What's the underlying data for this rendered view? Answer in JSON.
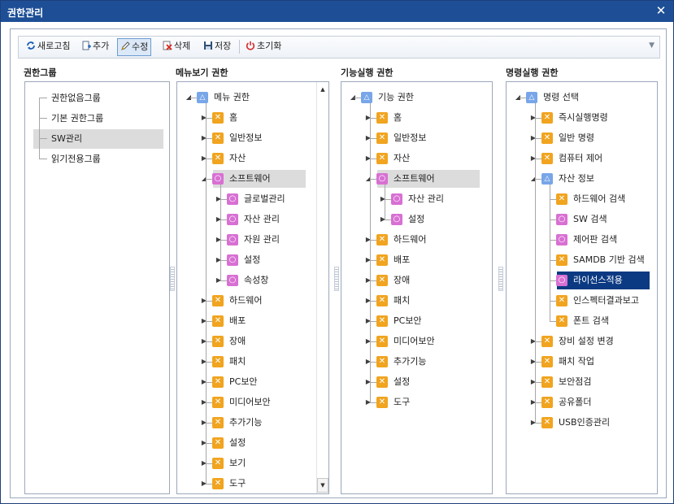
{
  "window": {
    "title": "권한관리",
    "close": "✕"
  },
  "toolbar": {
    "refresh": "새로고침",
    "add": "추가",
    "edit": "수정",
    "delete": "삭제",
    "save": "저장",
    "reset": "초기화"
  },
  "panels": {
    "groups_title": "권한그룹",
    "menu_title": "메뉴보기 권한",
    "func_title": "기능실행 권한",
    "cmd_title": "명령실행 권한"
  },
  "groups": [
    "권한없음그룹",
    "기본 권한그룹",
    "SW관리",
    "읽기전용그룹"
  ],
  "selected_group": "SW관리",
  "menu_tree": [
    {
      "label": "메뉴 권한",
      "icon": "t",
      "level": 0,
      "exp": "open"
    },
    {
      "label": "홈",
      "icon": "x",
      "level": 1,
      "exp": "closed"
    },
    {
      "label": "일반정보",
      "icon": "x",
      "level": 1,
      "exp": "closed"
    },
    {
      "label": "자산",
      "icon": "x",
      "level": 1,
      "exp": "closed"
    },
    {
      "label": "소프트웨어",
      "icon": "o",
      "level": 1,
      "exp": "open",
      "hl": true
    },
    {
      "label": "글로벌관리",
      "icon": "o",
      "level": 2,
      "exp": "closed"
    },
    {
      "label": "자산 관리",
      "icon": "o",
      "level": 2,
      "exp": "closed"
    },
    {
      "label": "자원 관리",
      "icon": "o",
      "level": 2,
      "exp": "closed"
    },
    {
      "label": "설정",
      "icon": "o",
      "level": 2,
      "exp": "closed"
    },
    {
      "label": "속성창",
      "icon": "o",
      "level": 2,
      "exp": "closed"
    },
    {
      "label": "하드웨어",
      "icon": "x",
      "level": 1,
      "exp": "closed"
    },
    {
      "label": "배포",
      "icon": "x",
      "level": 1,
      "exp": "closed"
    },
    {
      "label": "장애",
      "icon": "x",
      "level": 1,
      "exp": "closed"
    },
    {
      "label": "패치",
      "icon": "x",
      "level": 1,
      "exp": "closed"
    },
    {
      "label": "PC보안",
      "icon": "x",
      "level": 1,
      "exp": "closed"
    },
    {
      "label": "미디어보안",
      "icon": "x",
      "level": 1,
      "exp": "closed"
    },
    {
      "label": "추가기능",
      "icon": "x",
      "level": 1,
      "exp": "closed"
    },
    {
      "label": "설정",
      "icon": "x",
      "level": 1,
      "exp": "closed"
    },
    {
      "label": "보기",
      "icon": "x",
      "level": 1,
      "exp": "closed"
    },
    {
      "label": "도구",
      "icon": "x",
      "level": 1,
      "exp": "closed"
    }
  ],
  "func_tree": [
    {
      "label": "기능 권한",
      "icon": "t",
      "level": 0,
      "exp": "open"
    },
    {
      "label": "홈",
      "icon": "x",
      "level": 1,
      "exp": "closed"
    },
    {
      "label": "일반정보",
      "icon": "x",
      "level": 1,
      "exp": "closed"
    },
    {
      "label": "자산",
      "icon": "x",
      "level": 1,
      "exp": "closed"
    },
    {
      "label": "소프트웨어",
      "icon": "o",
      "level": 1,
      "exp": "open",
      "hl": true
    },
    {
      "label": "자산 관리",
      "icon": "o",
      "level": 2,
      "exp": "closed"
    },
    {
      "label": "설정",
      "icon": "o",
      "level": 2,
      "exp": "closed"
    },
    {
      "label": "하드웨어",
      "icon": "x",
      "level": 1,
      "exp": "closed"
    },
    {
      "label": "배포",
      "icon": "x",
      "level": 1,
      "exp": "closed"
    },
    {
      "label": "장애",
      "icon": "x",
      "level": 1,
      "exp": "closed"
    },
    {
      "label": "패치",
      "icon": "x",
      "level": 1,
      "exp": "closed"
    },
    {
      "label": "PC보안",
      "icon": "x",
      "level": 1,
      "exp": "closed"
    },
    {
      "label": "미디어보안",
      "icon": "x",
      "level": 1,
      "exp": "closed"
    },
    {
      "label": "추가기능",
      "icon": "x",
      "level": 1,
      "exp": "closed"
    },
    {
      "label": "설정",
      "icon": "x",
      "level": 1,
      "exp": "closed"
    },
    {
      "label": "도구",
      "icon": "x",
      "level": 1,
      "exp": "closed"
    }
  ],
  "cmd_tree": [
    {
      "label": "명령 선택",
      "icon": "t",
      "level": 0,
      "exp": "open"
    },
    {
      "label": "즉시실행명령",
      "icon": "x",
      "level": 1,
      "exp": "closed"
    },
    {
      "label": "일반 명령",
      "icon": "x",
      "level": 1,
      "exp": "closed"
    },
    {
      "label": "컴퓨터 제어",
      "icon": "x",
      "level": 1,
      "exp": "closed"
    },
    {
      "label": "자산 정보",
      "icon": "t",
      "level": 1,
      "exp": "open"
    },
    {
      "label": "하드웨어 검색",
      "icon": "x",
      "level": 2,
      "exp": "none"
    },
    {
      "label": "SW 검색",
      "icon": "o",
      "level": 2,
      "exp": "none"
    },
    {
      "label": "제어판 검색",
      "icon": "o",
      "level": 2,
      "exp": "none"
    },
    {
      "label": "SAMDB 기반 검색",
      "icon": "x",
      "level": 2,
      "exp": "none"
    },
    {
      "label": "라이선스적용",
      "icon": "o",
      "level": 2,
      "exp": "none",
      "sel": true
    },
    {
      "label": "인스펙터결과보고",
      "icon": "x",
      "level": 2,
      "exp": "none"
    },
    {
      "label": "폰트 검색",
      "icon": "x",
      "level": 2,
      "exp": "none"
    },
    {
      "label": "장비 설정 변경",
      "icon": "x",
      "level": 1,
      "exp": "closed"
    },
    {
      "label": "패치 작업",
      "icon": "x",
      "level": 1,
      "exp": "closed"
    },
    {
      "label": "보안점검",
      "icon": "x",
      "level": 1,
      "exp": "closed"
    },
    {
      "label": "공유폴더",
      "icon": "x",
      "level": 1,
      "exp": "closed"
    },
    {
      "label": "USB인증관리",
      "icon": "x",
      "level": 1,
      "exp": "closed"
    }
  ],
  "colors": {
    "titlebar": "#1e4f96",
    "x_icon": "#f1a41f",
    "o_icon": "#d870d3",
    "t_icon": "#78a6e8",
    "selection": "#0c3a82"
  }
}
